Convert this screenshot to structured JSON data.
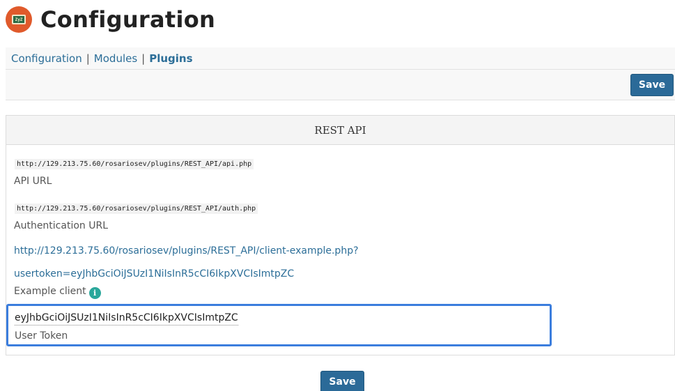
{
  "header": {
    "title": "Configuration",
    "logo_icon": "app-logo-icon",
    "logo_text": "ZyZ"
  },
  "breadcrumb": {
    "items": [
      {
        "label": "Configuration",
        "active": false
      },
      {
        "label": "Modules",
        "active": false
      },
      {
        "label": "Plugins",
        "active": true
      }
    ],
    "separator": "|"
  },
  "toolbar": {
    "save_label": "Save"
  },
  "panel": {
    "title": "REST API",
    "api_url": {
      "value": "http://129.213.75.60/rosariosev/plugins/REST_API/api.php",
      "label": "API URL"
    },
    "auth_url": {
      "value": "http://129.213.75.60/rosariosev/plugins/REST_API/auth.php",
      "label": "Authentication URL"
    },
    "example_client": {
      "link_line1": "http://129.213.75.60/rosariosev/plugins/REST_API/client-example.php?",
      "link_line2": "usertoken=eyJhbGciOiJSUzI1NiIsInR5cCI6IkpXVCIsImtpZC",
      "label": "Example client",
      "info_icon": "info-icon",
      "info_glyph": "i"
    },
    "user_token": {
      "value": "eyJhbGciOiJSUzI1NiIsInR5cCI6IkpXVCIsImtpZC",
      "label": "User Token"
    }
  },
  "footer": {
    "save_label": "Save"
  },
  "colors": {
    "accent": "#2b6a98",
    "link": "#2c6e98",
    "highlight_border": "#3b7ddd",
    "info_icon": "#2aa79b",
    "logo": "#e05a2b"
  }
}
